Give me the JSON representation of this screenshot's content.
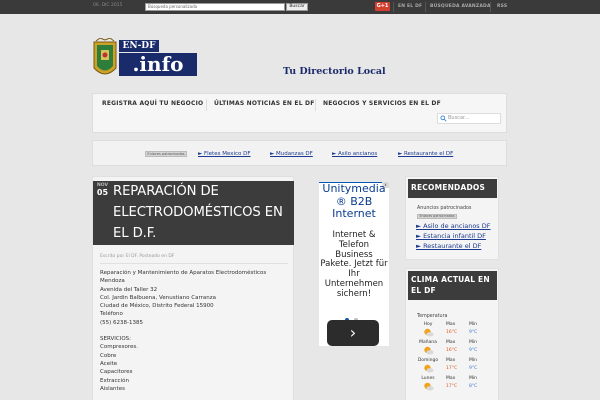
{
  "topbar": {
    "date": "06. DIC 2015",
    "search_placeholder": "Búsqueda personalizada",
    "search_button": "Buscar",
    "gplus": "G+1",
    "links": [
      "EN EL DF",
      "BÚSQUEDA AVANZADA",
      "RSS"
    ]
  },
  "header": {
    "logo_top": "EN-DF",
    "logo_bottom": ".info",
    "tagline": "Tu Directorio Local"
  },
  "nav": {
    "items": [
      "REGISTRA AQUÍ TU NEGOCIO",
      "ÚLTIMAS NOTICIAS EN EL DF",
      "NEGOCIOS Y SERVICIOS EN EL DF"
    ],
    "search_placeholder": "Buscar..."
  },
  "adbar": {
    "label": "Enlaces patrocinados",
    "links": [
      "► Fletes Mexico DF",
      "► Mudanzas DF",
      "► Asilo ancianos",
      "► Restaurante el DF"
    ]
  },
  "article": {
    "month": "NOV",
    "day": "05",
    "title": "REPARACIÓN DE ELECTRODOMÉSTICOS EN EL D.F.",
    "byline": "Escrito por El DF. Posteado en DF",
    "lines": [
      "Reparación y Mantenimiento de Aparatos Electrodomésticos",
      "Mendoza",
      "Avenida del Taller 32",
      "Col. Jardin Balbuena, Venustiano Carranza",
      "Ciudad de México, Distrito Federal 15900",
      "Teléfono",
      "(55) 6238-1385"
    ],
    "services": [
      "SERVICIOS:",
      "Compresores.",
      "Cobre",
      "Aceite",
      "Capacitores",
      "Extracción",
      "Aislantes"
    ]
  },
  "middle_ad": {
    "headline": "Unitymedia ® B2B Internet",
    "body": "Internet & Telefon Business Pakete. Jetzt für Ihr Unternehmen sichern!",
    "close": "x",
    "arrow": "›"
  },
  "recomendados": {
    "heading": "RECOMENDADOS",
    "label": "Anuncios patrocinados",
    "ad_label": "Enlaces patrocinados",
    "links": [
      "► Asilo de ancianos DF",
      "► Estancia infantil DF",
      "► Restaurante el DF"
    ]
  },
  "weather": {
    "heading": "CLIMA ACTUAL EN EL DF",
    "label": "Temperatura",
    "max_label": "Max",
    "min_label": "Min",
    "days": [
      {
        "day": "Hoy",
        "max": "16°C",
        "min": "9°C",
        "icon": "sunny-cloud-icon"
      },
      {
        "day": "Mañana",
        "max": "16°C",
        "min": "9°C",
        "icon": "sunny-cloud-icon"
      },
      {
        "day": "Domingo",
        "max": "17°C",
        "min": "9°C",
        "icon": "sunny-cloud-icon"
      },
      {
        "day": "Lunes",
        "max": "17°C",
        "min": "8°C",
        "icon": "sunny-cloud-icon"
      }
    ]
  },
  "colors": {
    "dark_box": "#3c3c3c",
    "link": "#1b3a8f",
    "logo_blue": "#1a2b6b",
    "max_temp": "#e05a1b",
    "min_temp": "#3b7bd8"
  }
}
